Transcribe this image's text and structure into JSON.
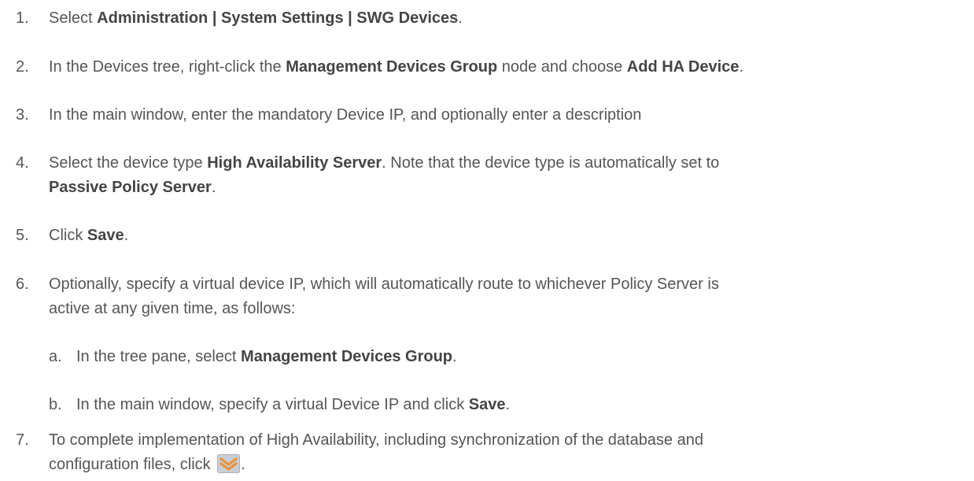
{
  "steps": [
    {
      "num": "1.",
      "parts": [
        {
          "t": "Select "
        },
        {
          "t": "Administration | System Settings | SWG Devices",
          "b": true
        },
        {
          "t": "."
        }
      ]
    },
    {
      "num": "2.",
      "parts": [
        {
          "t": "In the Devices tree, right-click the "
        },
        {
          "t": "Management Devices Group",
          "b": true
        },
        {
          "t": " node and choose "
        },
        {
          "t": "Add HA Device",
          "b": true
        },
        {
          "t": "."
        }
      ]
    },
    {
      "num": "3.",
      "parts": [
        {
          "t": "In the main window, enter the mandatory Device IP, and optionally enter a description"
        }
      ]
    },
    {
      "num": "4.",
      "line1": [
        {
          "t": "Select the device type "
        },
        {
          "t": "High Availability Server",
          "b": true
        },
        {
          "t": ". Note that the device type is automatically set to"
        }
      ],
      "line2": [
        {
          "t": "Passive Policy Server",
          "b": true
        },
        {
          "t": "."
        }
      ]
    },
    {
      "num": "5.",
      "parts": [
        {
          "t": "Click "
        },
        {
          "t": "Save",
          "b": true
        },
        {
          "t": "."
        }
      ]
    },
    {
      "num": "6.",
      "line1": [
        {
          "t": "Optionally, specify a virtual device IP, which will automatically route to whichever Policy Server is"
        }
      ],
      "line2": [
        {
          "t": "active at any given time, as follows:"
        }
      ]
    },
    {
      "num": "a.",
      "parts": [
        {
          "t": "In the tree pane, select "
        },
        {
          "t": "Management Devices Group",
          "b": true
        },
        {
          "t": "."
        }
      ]
    },
    {
      "num": "b.",
      "parts": [
        {
          "t": "In the main window, specify a virtual Device IP and click "
        },
        {
          "t": "Save",
          "b": true
        },
        {
          "t": "."
        }
      ]
    },
    {
      "num": "7.",
      "line1": [
        {
          "t": "To complete implementation of High Availability, including synchronization of the database and"
        }
      ],
      "line2": [
        {
          "t": "configuration files, click "
        },
        {
          "icon": "sync-chevron-icon"
        },
        {
          "t": "."
        }
      ]
    }
  ],
  "colors": {
    "text": "#555555",
    "bold": "#444444",
    "icon_orange": "#e8913a",
    "icon_bg": "#c9ced4"
  }
}
